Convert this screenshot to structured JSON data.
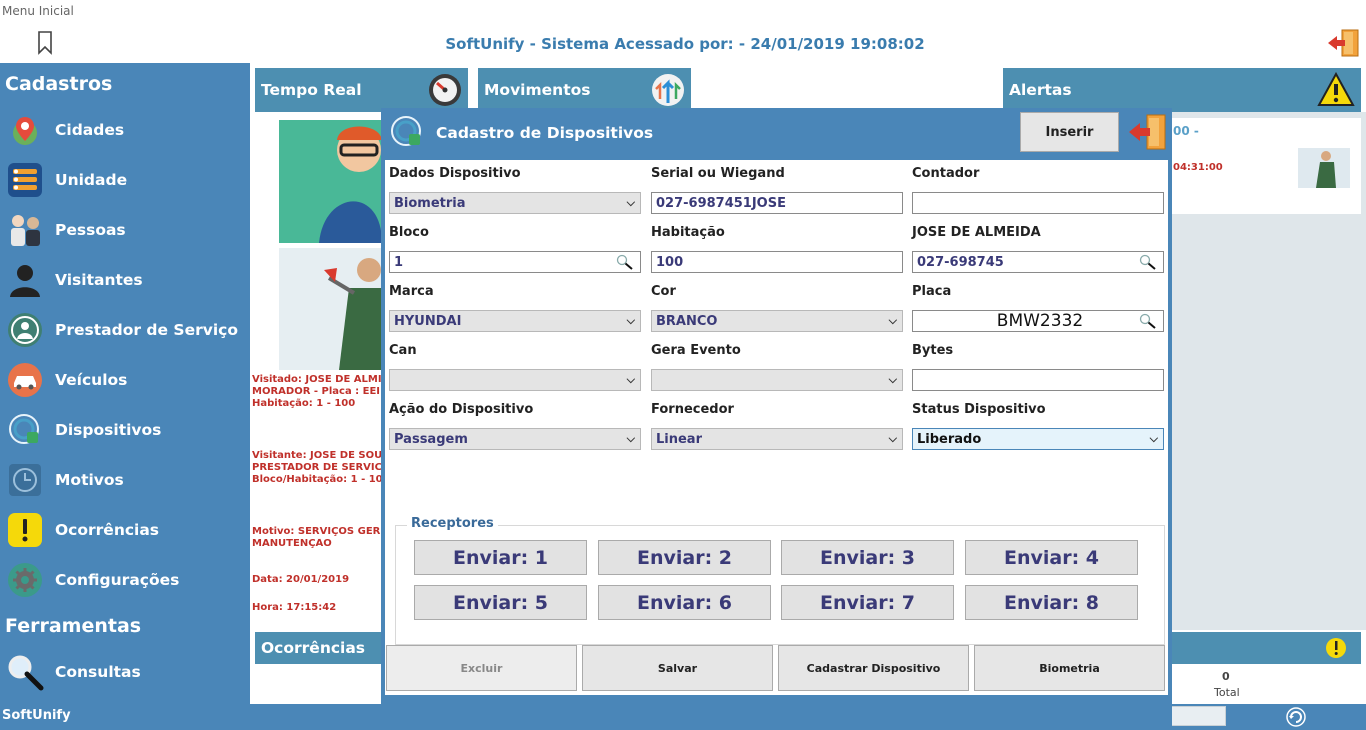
{
  "top": {
    "menu_label": "Menu Inicial",
    "header_title": "SoftUnify - Sistema Acessado por:  -  24/01/2019 19:08:02"
  },
  "sidebar": {
    "section_cadastros": "Cadastros",
    "section_ferramentas": "Ferramentas",
    "items": [
      {
        "label": "Cidades",
        "icon": "map-pin-icon"
      },
      {
        "label": "Unidade",
        "icon": "list-icon"
      },
      {
        "label": "Pessoas",
        "icon": "people-icon"
      },
      {
        "label": "Visitantes",
        "icon": "user-icon"
      },
      {
        "label": "Prestador de Serviço",
        "icon": "worker-icon"
      },
      {
        "label": "Veículos",
        "icon": "car-icon"
      },
      {
        "label": "Dispositivos",
        "icon": "device-icon"
      },
      {
        "label": "Motivos",
        "icon": "clock-icon"
      },
      {
        "label": "Ocorrências",
        "icon": "warning-icon"
      },
      {
        "label": "Configurações",
        "icon": "gear-icon"
      }
    ],
    "tools": [
      {
        "label": "Consultas",
        "icon": "search-icon"
      }
    ],
    "footer": "SoftUnify"
  },
  "dashboard": {
    "tempo_real": "Tempo Real",
    "movimentos": "Movimentos",
    "alertas": "Alertas",
    "ocorrencias": "Ocorrências",
    "visit_lines": [
      "Visitado: JOSE DE ALMI",
      "MORADOR - Placa : EEI",
      "Habitação: 1 - 100"
    ],
    "visitor_lines": [
      "Visitante: JOSE DE SOU",
      "PRESTADOR DE SERVIC",
      "Bloco/Habitação: 1 - 10"
    ],
    "motivo_lines": [
      "Motivo: SERVIÇOS GER",
      "MANUTENÇÃO"
    ],
    "data_line": "Data: 20/01/2019",
    "hora_line": "Hora: 17:15:42",
    "alert_time_a": "00 -",
    "alert_time_b": "04:31:00",
    "total_value": "0",
    "total_label": "Total"
  },
  "modal": {
    "title": "Cadastro de Dispositivos",
    "inserir": "Inserir",
    "fields": {
      "dados_dispositivo": {
        "label": "Dados Dispositivo",
        "value": "Biometria"
      },
      "serial": {
        "label": "Serial ou Wiegand",
        "value": "027-6987451JOSE"
      },
      "contador": {
        "label": "Contador",
        "value": ""
      },
      "bloco": {
        "label": "Bloco",
        "value": "1"
      },
      "habitacao": {
        "label": "Habitação",
        "value": "100"
      },
      "pessoa": {
        "label": "JOSE DE ALMEIDA",
        "value": "027-698745"
      },
      "marca": {
        "label": "Marca",
        "value": "HYUNDAI"
      },
      "cor": {
        "label": "Cor",
        "value": "BRANCO"
      },
      "placa": {
        "label": "Placa",
        "value": "BMW2332"
      },
      "can": {
        "label": "Can",
        "value": ""
      },
      "gera_evento": {
        "label": "Gera Evento",
        "value": ""
      },
      "bytes": {
        "label": "Bytes",
        "value": ""
      },
      "acao": {
        "label": "Ação do Dispositivo",
        "value": "Passagem"
      },
      "fornecedor": {
        "label": "Fornecedor",
        "value": "Linear"
      },
      "status": {
        "label": "Status Dispositivo",
        "value": "Liberado"
      }
    },
    "receptores_title": "Receptores",
    "send_buttons": [
      "Enviar: 1",
      "Enviar: 2",
      "Enviar: 3",
      "Enviar: 4",
      "Enviar: 5",
      "Enviar: 6",
      "Enviar: 7",
      "Enviar: 8"
    ],
    "footer_buttons": {
      "excluir": "Excluir",
      "salvar": "Salvar",
      "cadastrar": "Cadastrar Dispositivo",
      "biometria": "Biometria"
    }
  },
  "colors": {
    "sidebar": "#4a86b8",
    "panel_head": "#4d8fb1",
    "header_text": "#3a7cae",
    "alert_red": "#c0302a"
  }
}
